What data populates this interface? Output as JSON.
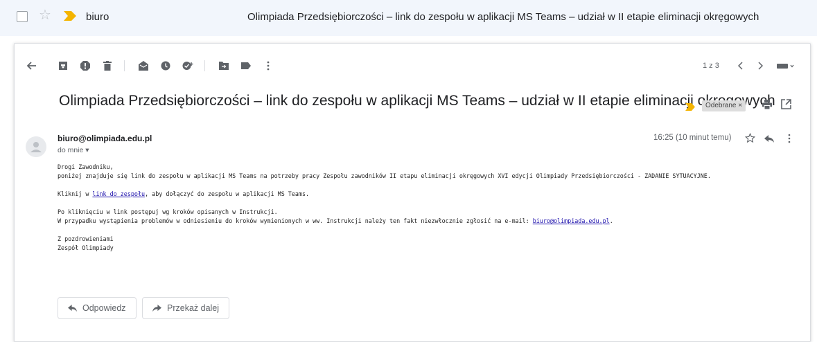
{
  "inbox_row": {
    "sender": "biuro",
    "subject": "Olimpiada Przedsiębiorczości – link do zespołu w aplikacji MS Teams – udział w II etapie eliminacji okręgowych"
  },
  "toolbar": {
    "icons": [
      "back-arrow-icon",
      "archive-icon",
      "report-spam-icon",
      "delete-icon",
      "mark-unread-icon",
      "snooze-icon",
      "add-to-tasks-icon",
      "move-to-icon",
      "labels-icon",
      "more-vert-icon"
    ],
    "pager_text": "1 z 3",
    "prev_icon": "chevron-left-icon",
    "next_icon": "chevron-right-icon",
    "input_tools_icon": "keyboard-icon"
  },
  "message": {
    "subject": "Olimpiada Przedsiębiorczości – link do zespołu w aplikacji MS Teams – udział w II etapie eliminacji okręgowych",
    "label": "Odebrane ×",
    "from": "biuro@olimpiada.edu.pl",
    "to": "do mnie ▾",
    "time": "16:25 (10 minut temu)",
    "body": {
      "line1": "Drogi Zawodniku,",
      "line2": "poniżej znajduje się link do zespołu w aplikacji MS Teams na potrzeby pracy Zespołu zawodników II etapu eliminacji okręgowych XVI edycji Olimpiady Przedsiębiorczości  - ZADANIE SYTUACYJNE.",
      "line3_pre": "Kliknij w ",
      "line3_link": "link do zespołu",
      "line3_post": ", aby dołączyć do zespołu w aplikacji MS Teams.",
      "line4": "Po kliknięciu w link postępuj wg kroków opisanych w Instrukcji.",
      "line5_pre": "W przypadku wystąpienia problemów w odniesieniu do kroków wymienionych w ww. Instrukcji należy ten fakt niezwłocznie zgłosić na e-mail: ",
      "line5_link": "biuro@olimpiada.edu.pl",
      "line5_post": ".",
      "line6": "Z pozdrowieniami",
      "line7": "Zespół Olimpiady"
    }
  },
  "actions": {
    "reply": "Odpowiedz",
    "forward": "Przekaż dalej"
  },
  "colors": {
    "important_marker": "#f4b400",
    "link": "#1a0dab",
    "icon": "#5f6368",
    "inbox_row_bg": "#f2f6fc"
  }
}
